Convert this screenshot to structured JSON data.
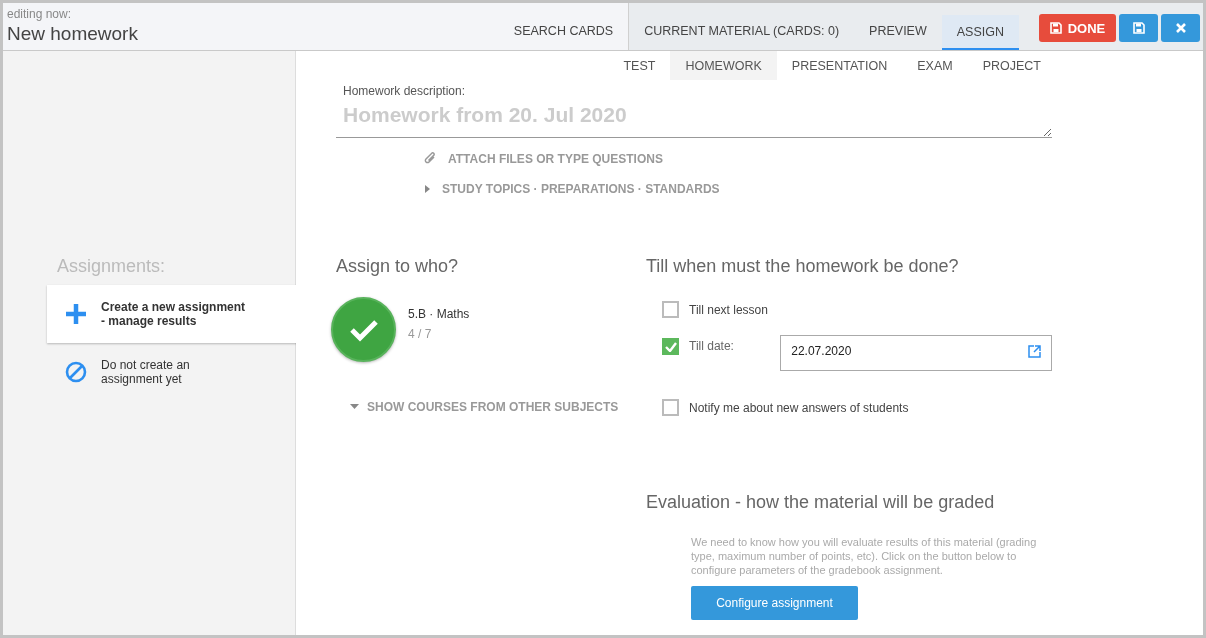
{
  "header": {
    "caption": "editing now:",
    "title": "New homework"
  },
  "tabs": [
    {
      "label": "SEARCH CARDS",
      "selected": false,
      "kind": "search"
    },
    {
      "label": "CURRENT MATERIAL (CARDS: 0)",
      "selected": false,
      "kind": "step"
    },
    {
      "label": "PREVIEW",
      "selected": false,
      "kind": "step"
    },
    {
      "label": "ASSIGN",
      "selected": true,
      "kind": "step"
    }
  ],
  "buttons": [
    {
      "kind": "done",
      "label": "DONE"
    },
    {
      "kind": "save"
    },
    {
      "kind": "close"
    }
  ],
  "type_tabs": [
    {
      "label": "TEST",
      "selected": false
    },
    {
      "label": "HOMEWORK",
      "selected": true
    },
    {
      "label": "PRESENTATION",
      "selected": false
    },
    {
      "label": "EXAM",
      "selected": false
    },
    {
      "label": "PROJECT",
      "selected": false
    }
  ],
  "description": {
    "label": "Homework description:",
    "placeholder": "Homework from 20. Jul 2020"
  },
  "links": [
    {
      "kind": "attach",
      "label": "ATTACH FILES OR TYPE QUESTIONS"
    },
    {
      "kind": "expand",
      "label": "STUDY TOPICS · PREPARATIONS · STANDARDS"
    }
  ],
  "sidebar": {
    "title": "Assignments:",
    "items": [
      {
        "kind": "create",
        "label": "Create a new assignment\n- manage results",
        "selected": true
      },
      {
        "kind": "none",
        "label": "Do not create an\nassignment yet",
        "selected": false
      }
    ]
  },
  "assign": {
    "title": "Assign to who?",
    "courses": [
      {
        "name": "5.B · Maths",
        "count": "4 / 7",
        "selected": true
      }
    ],
    "more": "SHOW COURSES FROM OTHER SUBJECTS"
  },
  "deadline": {
    "title": "Till when must the homework be done?",
    "options": [
      {
        "kind": "check",
        "label": "Till next lesson",
        "checked": false
      },
      {
        "kind": "date",
        "label": "Till date:",
        "checked": true,
        "value": "22.07.2020"
      },
      {
        "kind": "check",
        "label": "Notify me about new answers of students",
        "checked": false
      }
    ]
  },
  "evaluation": {
    "title": "Evaluation - how the material will be graded",
    "text": "We need to know how you will evaluate results of this material (grading type, maximum number of points, etc). Click on the button below to configure parameters of the gradebook assignment.",
    "button": "Configure assignment"
  }
}
